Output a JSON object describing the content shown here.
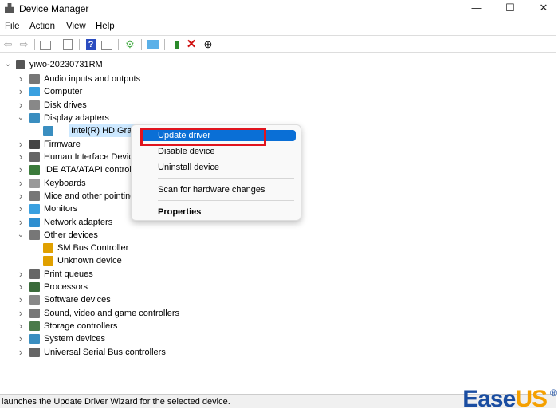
{
  "window": {
    "title": "Device Manager",
    "controls": [
      "—",
      "☐",
      "✕"
    ]
  },
  "menubar": [
    "File",
    "Action",
    "View",
    "Help"
  ],
  "toolbar": [
    "back-icon",
    "forward-icon",
    "show-hide-console-tree-icon",
    "properties-icon",
    "help-icon",
    "action-pane-icon",
    "scan-hardware-icon",
    "monitor-icon",
    "update-driver-icon",
    "uninstall-icon",
    "disable-icon"
  ],
  "tree": {
    "root": "yiwo-20230731RM",
    "items": [
      {
        "label": "Audio inputs and outputs",
        "expanded": false,
        "color": "#777"
      },
      {
        "label": "Computer",
        "expanded": false,
        "color": "#3aa0e0"
      },
      {
        "label": "Disk drives",
        "expanded": false,
        "color": "#888"
      },
      {
        "label": "Display adapters",
        "expanded": true,
        "color": "#3a8ec0"
      },
      {
        "label": "Intel(R) HD Graphics",
        "child": true,
        "selected": true,
        "color": "#3a8ec0"
      },
      {
        "label": "Firmware",
        "expanded": false,
        "color": "#444"
      },
      {
        "label": "Human Interface Devices",
        "expanded": false,
        "color": "#666"
      },
      {
        "label": "IDE ATA/ATAPI controllers",
        "expanded": false,
        "color": "#3a7a3a"
      },
      {
        "label": "Keyboards",
        "expanded": false,
        "color": "#999"
      },
      {
        "label": "Mice and other pointing devices",
        "expanded": false,
        "color": "#777"
      },
      {
        "label": "Monitors",
        "expanded": false,
        "color": "#3aa0e0"
      },
      {
        "label": "Network adapters",
        "expanded": false,
        "color": "#2f8fd0"
      },
      {
        "label": "Other devices",
        "expanded": true,
        "color": "#777"
      },
      {
        "label": "SM Bus Controller",
        "child": true,
        "color": "#e0a000"
      },
      {
        "label": "Unknown device",
        "child": true,
        "color": "#e0a000"
      },
      {
        "label": "Print queues",
        "expanded": false,
        "color": "#666"
      },
      {
        "label": "Processors",
        "expanded": false,
        "color": "#3a6a3a"
      },
      {
        "label": "Software devices",
        "expanded": false,
        "color": "#888"
      },
      {
        "label": "Sound, video and game controllers",
        "expanded": false,
        "color": "#777"
      },
      {
        "label": "Storage controllers",
        "expanded": false,
        "color": "#4a7a4a"
      },
      {
        "label": "System devices",
        "expanded": false,
        "color": "#3a8ec0"
      },
      {
        "label": "Universal Serial Bus controllers",
        "expanded": false,
        "color": "#666"
      }
    ]
  },
  "context_menu": {
    "items": [
      "Update driver",
      "Disable device",
      "Uninstall device",
      "Scan for hardware changes",
      "Properties"
    ]
  },
  "status": "launches the Update Driver Wizard for the selected device.",
  "logo": {
    "part1": "Ease",
    "part2": "US",
    "reg": "®"
  }
}
